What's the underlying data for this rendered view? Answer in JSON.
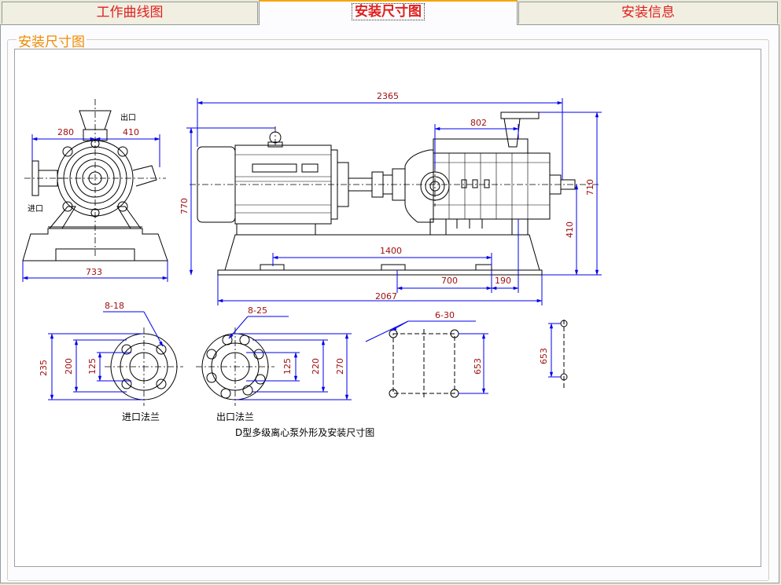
{
  "tabs": [
    {
      "label": "工作曲线图",
      "active": false
    },
    {
      "label": "安装尺寸图",
      "active": true
    },
    {
      "label": "安装信息",
      "active": false
    }
  ],
  "group_title": "安装尺寸图",
  "drawing": {
    "dims": {
      "d280": "280",
      "d410": "410",
      "d733": "733",
      "d2365": "2365",
      "d802": "802",
      "d770": "770",
      "d710": "710",
      "d410b": "410",
      "d1400": "1400",
      "d700": "700",
      "d190": "190",
      "d2067": "2067",
      "d8_18": "8-18",
      "d8_25": "8-25",
      "d6_30": "6-30",
      "d235": "235",
      "d200": "200",
      "d125a": "125",
      "d125b": "125",
      "d220": "220",
      "d270": "270",
      "d653a": "653",
      "d653b": "653"
    },
    "labels": {
      "outlet": "出口",
      "inlet": "进口",
      "inlet_flange": "进口法兰",
      "outlet_flange": "出口法兰",
      "caption": "D型多级离心泵外形及安装尺寸图"
    }
  },
  "colors": {
    "tab_text": "#e0201e",
    "group_title": "#f08a00",
    "dim_line": "#0000ee",
    "dim_text": "#a01010",
    "drawing": "#000000"
  }
}
